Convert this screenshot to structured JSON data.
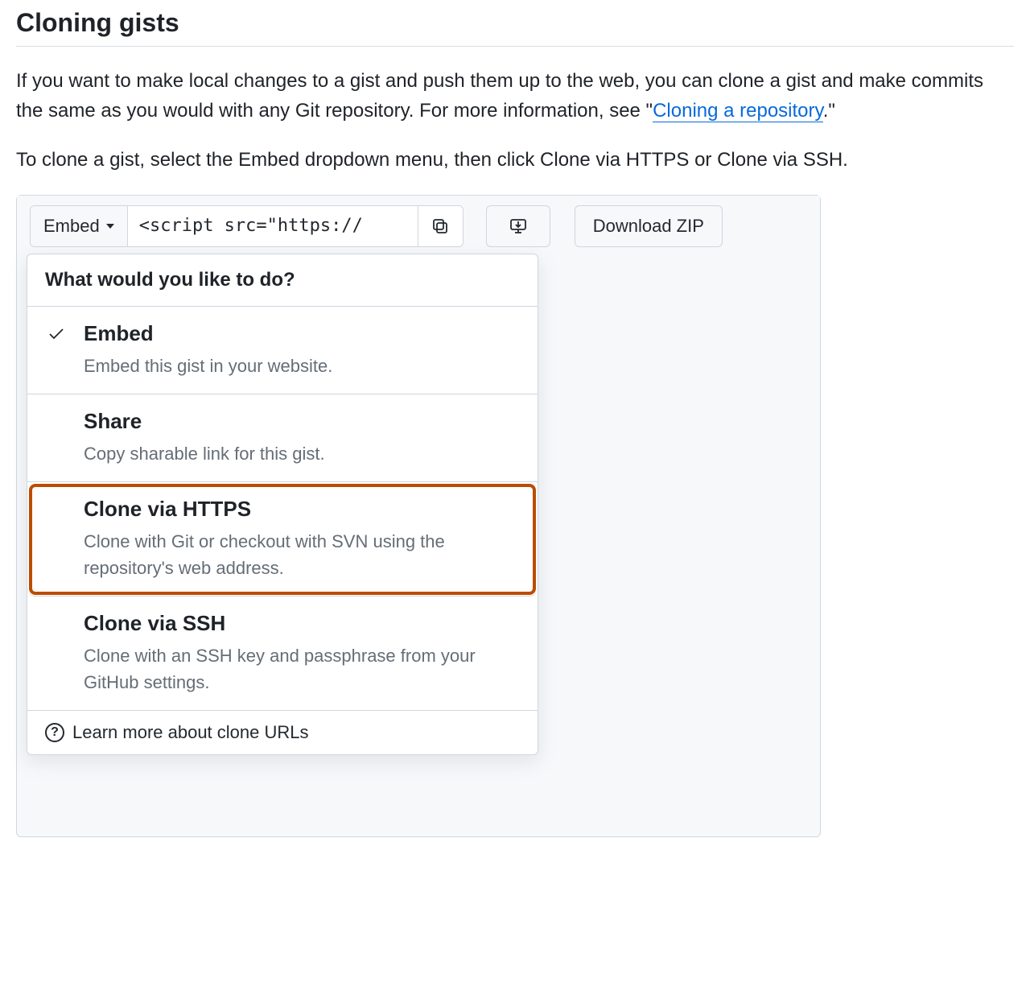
{
  "heading": "Cloning gists",
  "para1_pre": "If you want to make local changes to a gist and push them up to the web, you can clone a gist and make commits the same as you would with any Git repository. For more information, see \"",
  "para1_link": "Cloning a repository",
  "para1_post": ".\"",
  "para2": "To clone a gist, select the Embed dropdown menu, then click Clone via HTTPS or Clone via SSH.",
  "toolbar": {
    "embed_label": "Embed",
    "url_value": "<script src=\"https://",
    "download_label": "Download ZIP"
  },
  "dropdown": {
    "header": "What would you like to do?",
    "items": [
      {
        "title": "Embed",
        "desc": "Embed this gist in your website.",
        "selected": true,
        "highlight": false
      },
      {
        "title": "Share",
        "desc": "Copy sharable link for this gist.",
        "selected": false,
        "highlight": false
      },
      {
        "title": "Clone via HTTPS",
        "desc": "Clone with Git or checkout with SVN using the repository's web address.",
        "selected": false,
        "highlight": true
      },
      {
        "title": "Clone via SSH",
        "desc": "Clone with an SSH key and passphrase from your GitHub settings.",
        "selected": false,
        "highlight": false
      }
    ],
    "footer": "Learn more about clone URLs"
  }
}
